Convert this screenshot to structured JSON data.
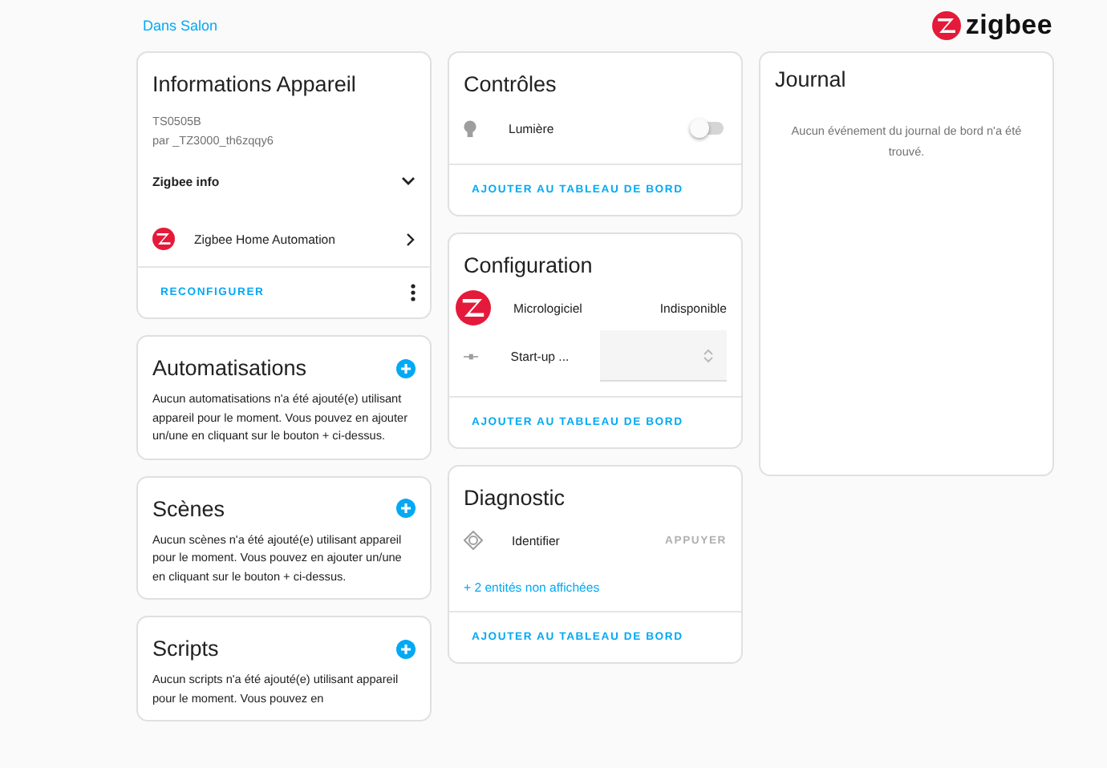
{
  "breadcrumb": "Dans Salon",
  "brand": "zigbee",
  "device_info": {
    "title": "Informations Appareil",
    "model": "TS0505B",
    "manufacturer": "par _TZ3000_th6zqqy6",
    "expander": {
      "label": "Zigbee info",
      "expanded": false
    },
    "integration": "Zigbee Home Automation",
    "action": "RECONFIGURER"
  },
  "related": [
    {
      "title": "Automatisations",
      "text": "Aucun automatisations n'a été ajouté(e) utilisant appareil pour le moment. Vous pouvez en ajouter un/une en cliquant sur le bouton + ci-dessus."
    },
    {
      "title": "Scènes",
      "text": "Aucun scènes n'a été ajouté(e) utilisant appareil pour le moment. Vous pouvez en ajouter un/une en cliquant sur le bouton + ci-dessus."
    },
    {
      "title": "Scripts",
      "text": "Aucun scripts n'a été ajouté(e) utilisant appareil pour le moment. Vous pouvez en"
    }
  ],
  "controls": {
    "title": "Contrôles",
    "entities": [
      {
        "name": "Lumière",
        "on": false
      }
    ],
    "action": "AJOUTER AU TABLEAU DE BORD"
  },
  "configuration": {
    "title": "Configuration",
    "rows": [
      {
        "kind": "text",
        "name": "Micrologiciel",
        "value": "Indisponible"
      },
      {
        "kind": "select",
        "name": "Start-up ..."
      }
    ],
    "action": "AJOUTER AU TABLEAU DE BORD"
  },
  "diagnostic": {
    "title": "Diagnostic",
    "entities": [
      {
        "name": "Identifier",
        "button": "APPUYER"
      }
    ],
    "hidden": "+ 2 entités non affichées",
    "action": "AJOUTER AU TABLEAU DE BORD"
  },
  "journal": {
    "title": "Journal",
    "empty": "Aucun événement du journal de bord n'a été trouvé."
  }
}
